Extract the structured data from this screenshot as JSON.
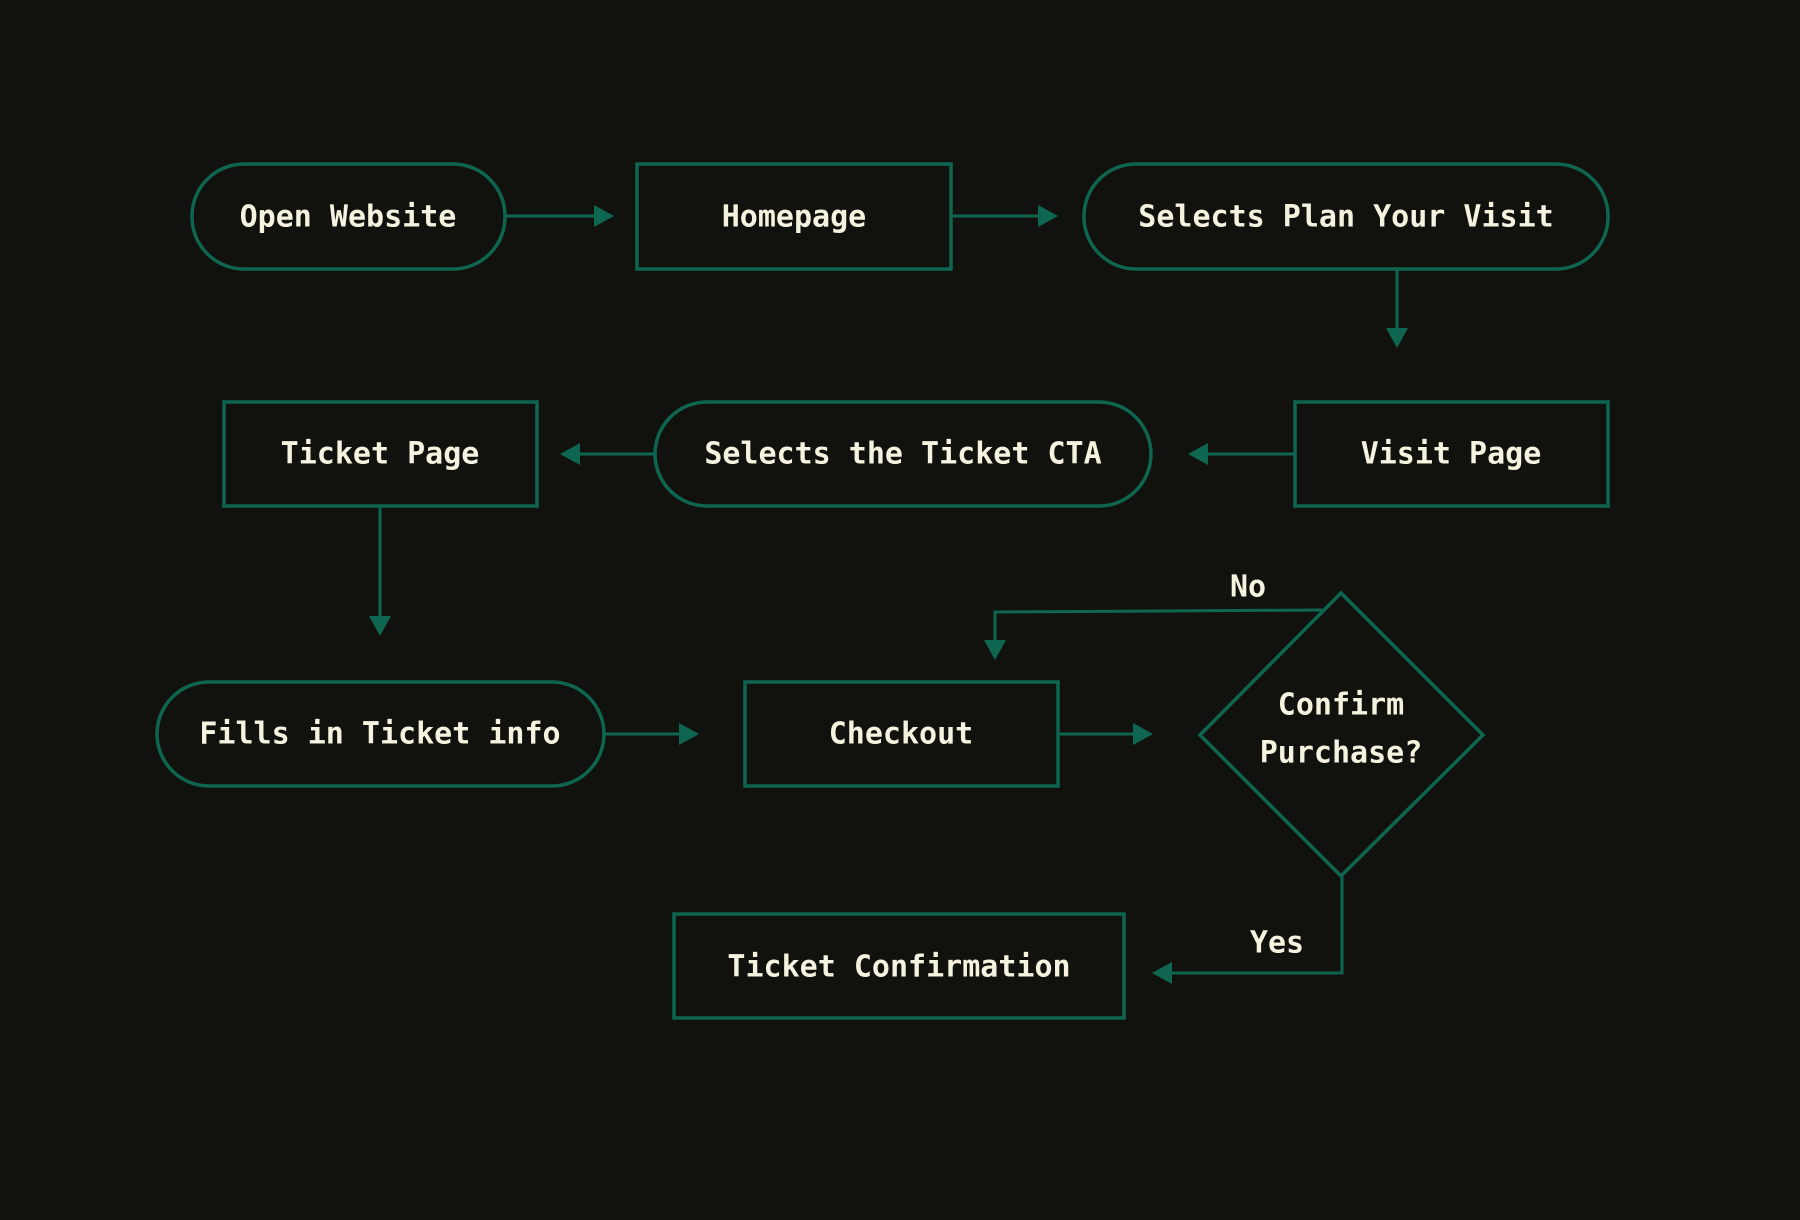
{
  "diagram": {
    "nodes": {
      "open_website": "Open Website",
      "homepage": "Homepage",
      "selects_plan": "Selects Plan Your Visit",
      "visit_page": "Visit Page",
      "selects_ticket_cta": "Selects the Ticket CTA",
      "ticket_page": "Ticket Page",
      "fills_info": "Fills in Ticket info",
      "checkout": "Checkout",
      "confirm_line1": "Confirm",
      "confirm_line2": "Purchase?",
      "ticket_confirmation": "Ticket Confirmation"
    },
    "edge_labels": {
      "no": "No",
      "yes": "Yes"
    },
    "colors": {
      "background": "#11120e",
      "stroke": "#0e6650",
      "text": "#f5f3df"
    }
  }
}
